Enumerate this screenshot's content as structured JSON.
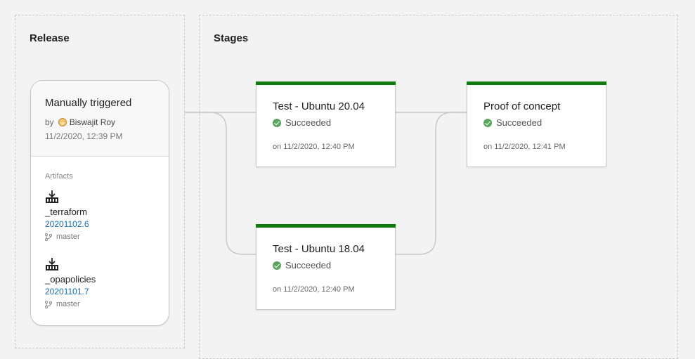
{
  "release_panel": {
    "title": "Release",
    "trigger": "Manually triggered",
    "by_label": "by",
    "user": "Biswajit Roy",
    "date": "11/2/2020, 12:39 PM",
    "artifacts_label": "Artifacts",
    "artifacts": [
      {
        "name": "_terraform",
        "version": "20201102.6",
        "branch": "master",
        "icon": "build-artifact-icon"
      },
      {
        "name": "_opapolicies",
        "version": "20201101.7",
        "branch": "master",
        "icon": "build-artifact-icon"
      }
    ]
  },
  "stages_panel": {
    "title": "Stages",
    "stages": [
      {
        "name": "Test - Ubuntu 20.04",
        "status": "Succeeded",
        "when": "on 11/2/2020, 12:40 PM"
      },
      {
        "name": "Proof of concept",
        "status": "Succeeded",
        "when": "on 11/2/2020, 12:41 PM"
      },
      {
        "name": "Test - Ubuntu 18.04",
        "status": "Succeeded",
        "when": "on 11/2/2020, 12:40 PM"
      }
    ]
  },
  "colors": {
    "success": "#107c10",
    "success_icon": "#5aa55e",
    "link": "#106ebe",
    "background": "#f3f3f3"
  }
}
